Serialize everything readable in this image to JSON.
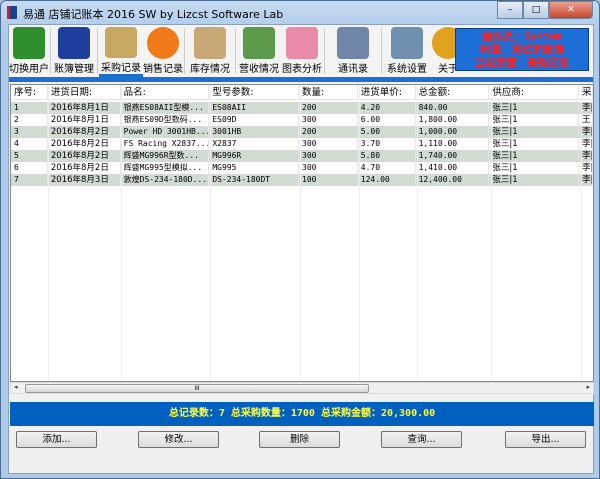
{
  "window": {
    "title": "易通 店铺记账本 2016 SW   by Lizcst Software Lab",
    "minimize": "–",
    "maximize": "□",
    "close": "✕"
  },
  "toolbar": [
    {
      "label": "切换用户",
      "icon": "switch-user-icon",
      "color": "#2f8f2f"
    },
    {
      "label": "账簿管理",
      "icon": "ledger-book-icon",
      "color": "#1f3f9f"
    },
    {
      "label": "采购记录",
      "icon": "purchase-box-icon",
      "color": "#c8a860",
      "active": true
    },
    {
      "label": "销售记录",
      "icon": "dollar-icon",
      "color": "#f07a1a"
    },
    {
      "label": "库存情况",
      "icon": "inventory-box-icon",
      "color": "#c9a878"
    },
    {
      "label": "营收情况",
      "icon": "revenue-money-icon",
      "color": "#5a9a4a"
    },
    {
      "label": "图表分析",
      "icon": "chart-icon",
      "color": "#e88aa8"
    },
    {
      "label": "通讯录",
      "icon": "address-book-icon",
      "color": "#6f86a8"
    },
    {
      "label": "系统设置",
      "icon": "tools-icon",
      "color": "#7090b0"
    },
    {
      "label": "关于",
      "icon": "about-info-icon",
      "color": "#e0a020"
    }
  ],
  "info": {
    "operator": "操作员：System",
    "ledger": "账簿：测试的账簿",
    "page": "当前页面：采购记录"
  },
  "colors": {
    "accent": "#1c6fd6",
    "status_bg": "#0060c0",
    "status_text": "#ffff40",
    "row_alt": "#cfdccf",
    "info_text": "#ff2020"
  },
  "table": {
    "columns": [
      "序号:",
      "进货日期:",
      "品名:",
      "型号参数:",
      "数量:",
      "进货单价:",
      "总金额:",
      "供应商:",
      "采"
    ],
    "rows": [
      [
        "1",
        "2016年8月1日",
        "银燕ES08AII型模...",
        "ES08AII",
        "200",
        "4.20",
        "840.00",
        "张三|1",
        "李|"
      ],
      [
        "2",
        "2016年8月1日",
        "银燕ES09D型数码...",
        "ES09D",
        "300",
        "6.00",
        "1,800.00",
        "张三|1",
        "王"
      ],
      [
        "3",
        "2016年8月2日",
        "Power HD 3001HB...",
        "3001HB",
        "200",
        "5.00",
        "1,000.00",
        "张三|1",
        "李|"
      ],
      [
        "4",
        "2016年8月2日",
        "FS Racing X2837...",
        "X2837",
        "300",
        "3.70",
        "1,110.00",
        "张三|1",
        "李|"
      ],
      [
        "5",
        "2016年8月2日",
        "辉盛MG996R型数...",
        "MG996R",
        "300",
        "5.80",
        "1,740.00",
        "张三|1",
        "李|"
      ],
      [
        "6",
        "2016年8月2日",
        "辉盛MG995型模拟...",
        "MG995",
        "300",
        "4.70",
        "1,410.00",
        "张三|1",
        "李|"
      ],
      [
        "7",
        "2016年8月3日",
        "敦煌DS-234-180D...",
        "DS-234-180DT",
        "100",
        "124.00",
        "12,400.00",
        "张三|1",
        "李|"
      ]
    ]
  },
  "scrollbar": {
    "grip": "III",
    "left": "◂",
    "right": "▸"
  },
  "status": "总记录数：7  总采购数量：1700  总采购金额：20,300.00",
  "buttons": {
    "add": "添加...",
    "edit": "修改...",
    "delete": "删除",
    "query": "查询...",
    "export": "导出..."
  }
}
